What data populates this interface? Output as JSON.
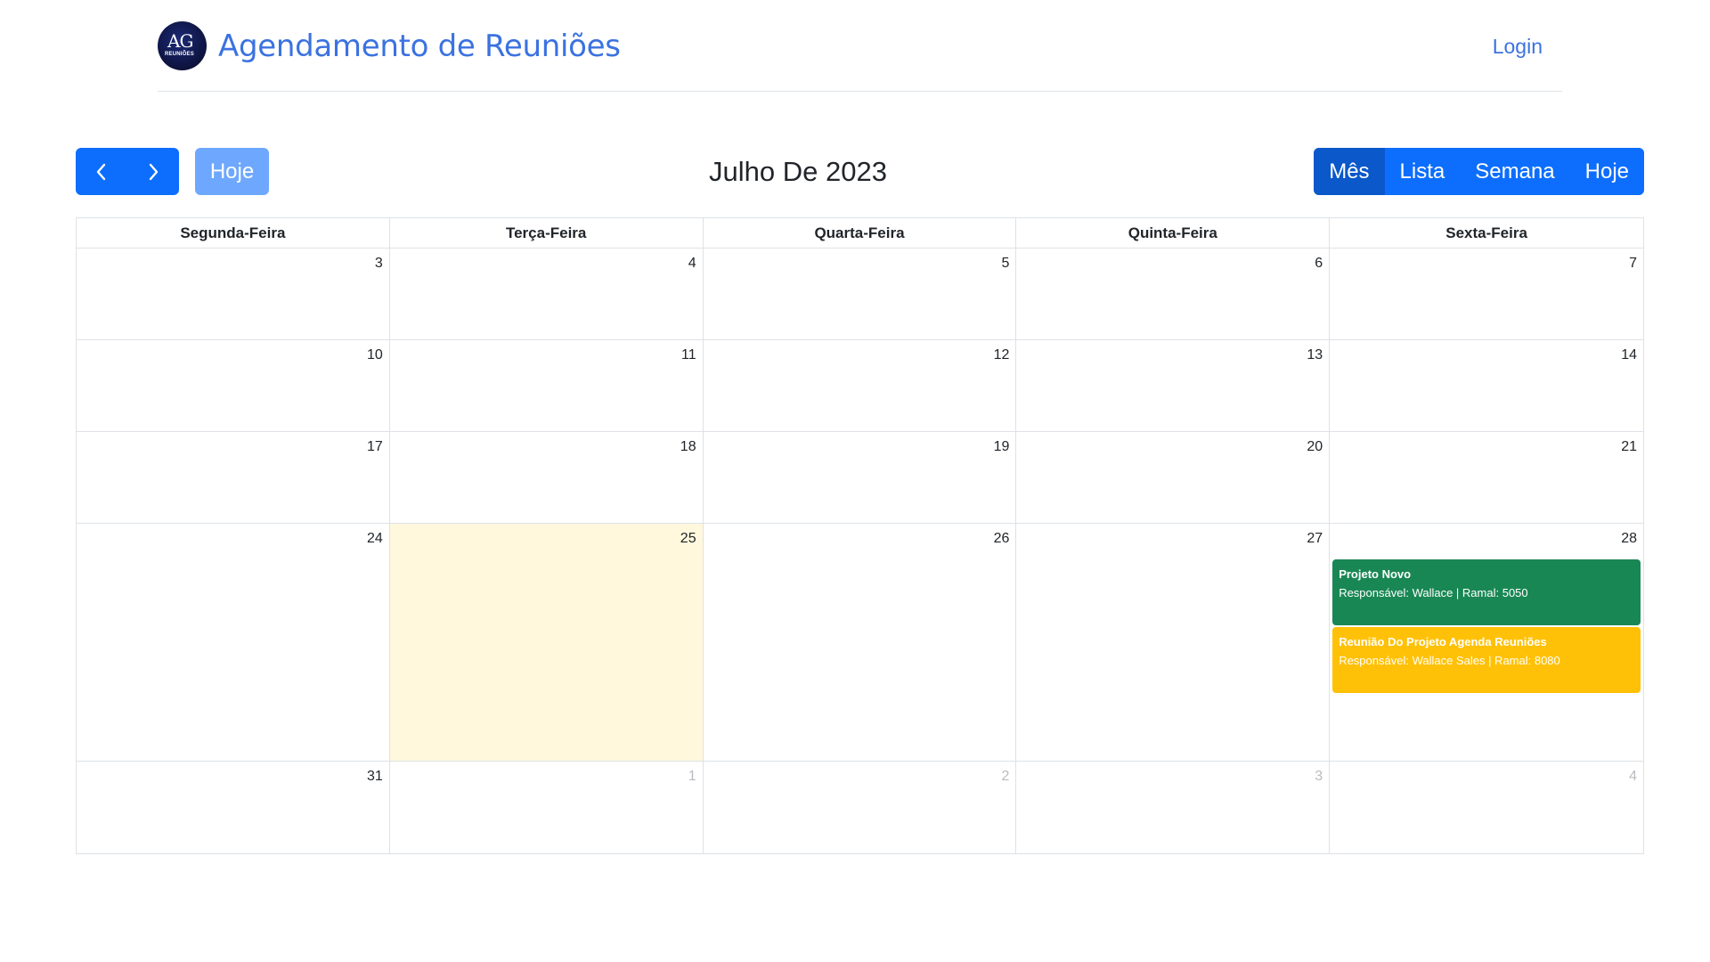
{
  "header": {
    "logo_main": "AG",
    "logo_sub": "REUNIÕES",
    "title": "Agendamento de Reuniões",
    "login_label": "Login"
  },
  "toolbar": {
    "prev_icon": "chevron-left-icon",
    "next_icon": "chevron-right-icon",
    "today_label": "Hoje",
    "title": "Julho De 2023",
    "views": [
      {
        "label": "Mês",
        "active": true
      },
      {
        "label": "Lista",
        "active": false
      },
      {
        "label": "Semana",
        "active": false
      },
      {
        "label": "Hoje",
        "active": false
      }
    ]
  },
  "calendar": {
    "day_headers": [
      "Segunda-Feira",
      "Terça-Feira",
      "Quarta-Feira",
      "Quinta-Feira",
      "Sexta-Feira"
    ],
    "weeks": [
      {
        "days": [
          {
            "num": "3"
          },
          {
            "num": "4"
          },
          {
            "num": "5"
          },
          {
            "num": "6"
          },
          {
            "num": "7"
          }
        ]
      },
      {
        "days": [
          {
            "num": "10"
          },
          {
            "num": "11"
          },
          {
            "num": "12"
          },
          {
            "num": "13"
          },
          {
            "num": "14"
          }
        ]
      },
      {
        "days": [
          {
            "num": "17"
          },
          {
            "num": "18"
          },
          {
            "num": "19"
          },
          {
            "num": "20"
          },
          {
            "num": "21"
          }
        ]
      },
      {
        "days": [
          {
            "num": "24"
          },
          {
            "num": "25",
            "today": true
          },
          {
            "num": "26"
          },
          {
            "num": "27"
          },
          {
            "num": "28",
            "events": [
              {
                "title": "Projeto Novo",
                "desc": "Responsável: Wallace | Ramal: 5050",
                "color": "#198754"
              },
              {
                "title": "Reunião Do Projeto Agenda Reuniões",
                "desc": "Responsável: Wallace Sales | Ramal: 8080",
                "color": "#ffc107"
              }
            ]
          }
        ]
      },
      {
        "days": [
          {
            "num": "31"
          },
          {
            "num": "1",
            "other_month": true
          },
          {
            "num": "2",
            "other_month": true
          },
          {
            "num": "3",
            "other_month": true
          },
          {
            "num": "4",
            "other_month": true
          }
        ]
      }
    ],
    "colors": {
      "today_bg": "#fff8dd",
      "primary": "#0d6efd",
      "primary_active": "#0a58ca",
      "primary_light": "#6ea8fe",
      "link": "#3b72e0"
    }
  }
}
